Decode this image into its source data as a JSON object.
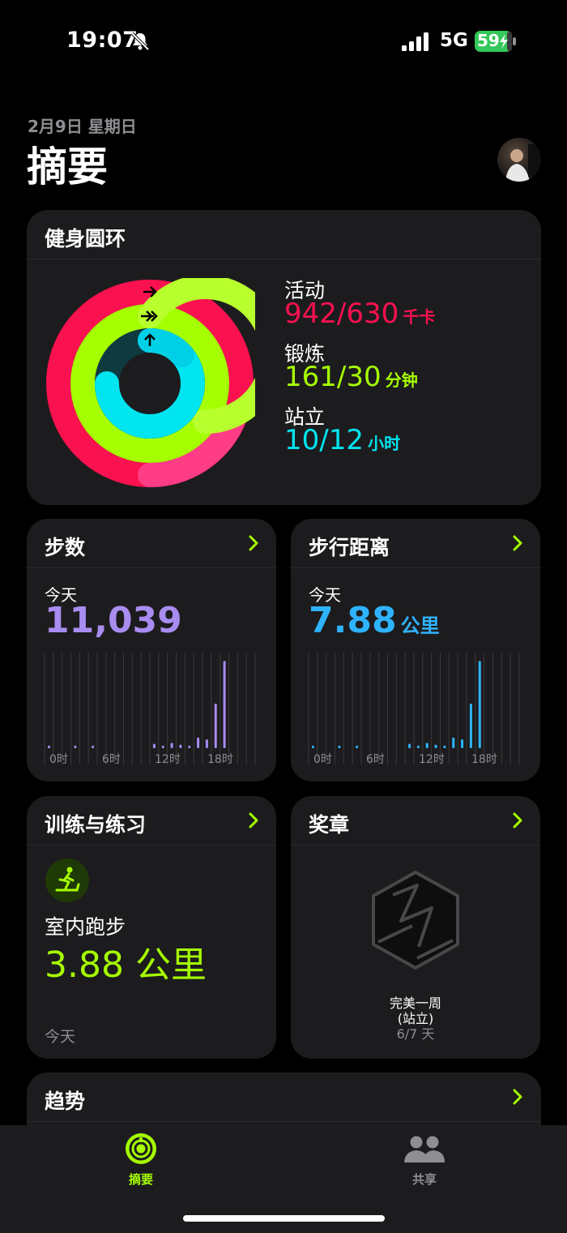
{
  "status": {
    "time": "19:07",
    "network": "5G",
    "battery": "59"
  },
  "header": {
    "date": "2月9日 星期日",
    "title": "摘要"
  },
  "rings_card": {
    "title": "健身圆环",
    "move": {
      "label": "活动",
      "value": "942/630",
      "unit": "千卡",
      "progress": 1.495
    },
    "exercise": {
      "label": "锻炼",
      "value": "161/30",
      "unit": "分钟",
      "progress": 5.37
    },
    "stand": {
      "label": "站立",
      "value": "10/12",
      "unit": "小时",
      "progress": 0.833
    },
    "colors": {
      "move": "#fa114f",
      "exercise": "#a6ff00",
      "stand": "#00e5f0"
    }
  },
  "steps_card": {
    "title": "步数",
    "period": "今天",
    "value": "11,039",
    "ticks": [
      "0时",
      "6时",
      "12时",
      "18时"
    ],
    "color": "#a98cf0",
    "hourly": [
      0.03,
      0,
      0,
      0.03,
      0,
      0.03,
      0,
      0,
      0,
      0,
      0,
      0,
      0.05,
      0.03,
      0.06,
      0.04,
      0.03,
      0.12,
      0.1,
      0.5,
      0.98,
      0,
      0,
      0
    ]
  },
  "distance_card": {
    "title": "步行距离",
    "period": "今天",
    "value": "7.88",
    "unit": "公里",
    "ticks": [
      "0时",
      "6时",
      "12时",
      "18时"
    ],
    "color": "#2fb3ff",
    "hourly": [
      0.03,
      0,
      0,
      0.03,
      0,
      0.03,
      0,
      0,
      0,
      0,
      0,
      0.05,
      0.03,
      0.06,
      0.04,
      0.03,
      0.12,
      0.1,
      0.5,
      0.98,
      0,
      0,
      0,
      0
    ]
  },
  "workout_card": {
    "title": "训练与练习",
    "name": "室内跑步",
    "value": "3.88 公里",
    "period": "今天"
  },
  "awards_card": {
    "title": "奖章",
    "award_line1": "完美一周",
    "award_line2": "(站立)",
    "award_progress": "6/7 天"
  },
  "trends_card": {
    "title": "趋势"
  },
  "tabs": [
    {
      "label": "摘要",
      "icon": "activity-rings-icon",
      "active": true
    },
    {
      "label": "共享",
      "icon": "people-icon",
      "active": false
    }
  ]
}
